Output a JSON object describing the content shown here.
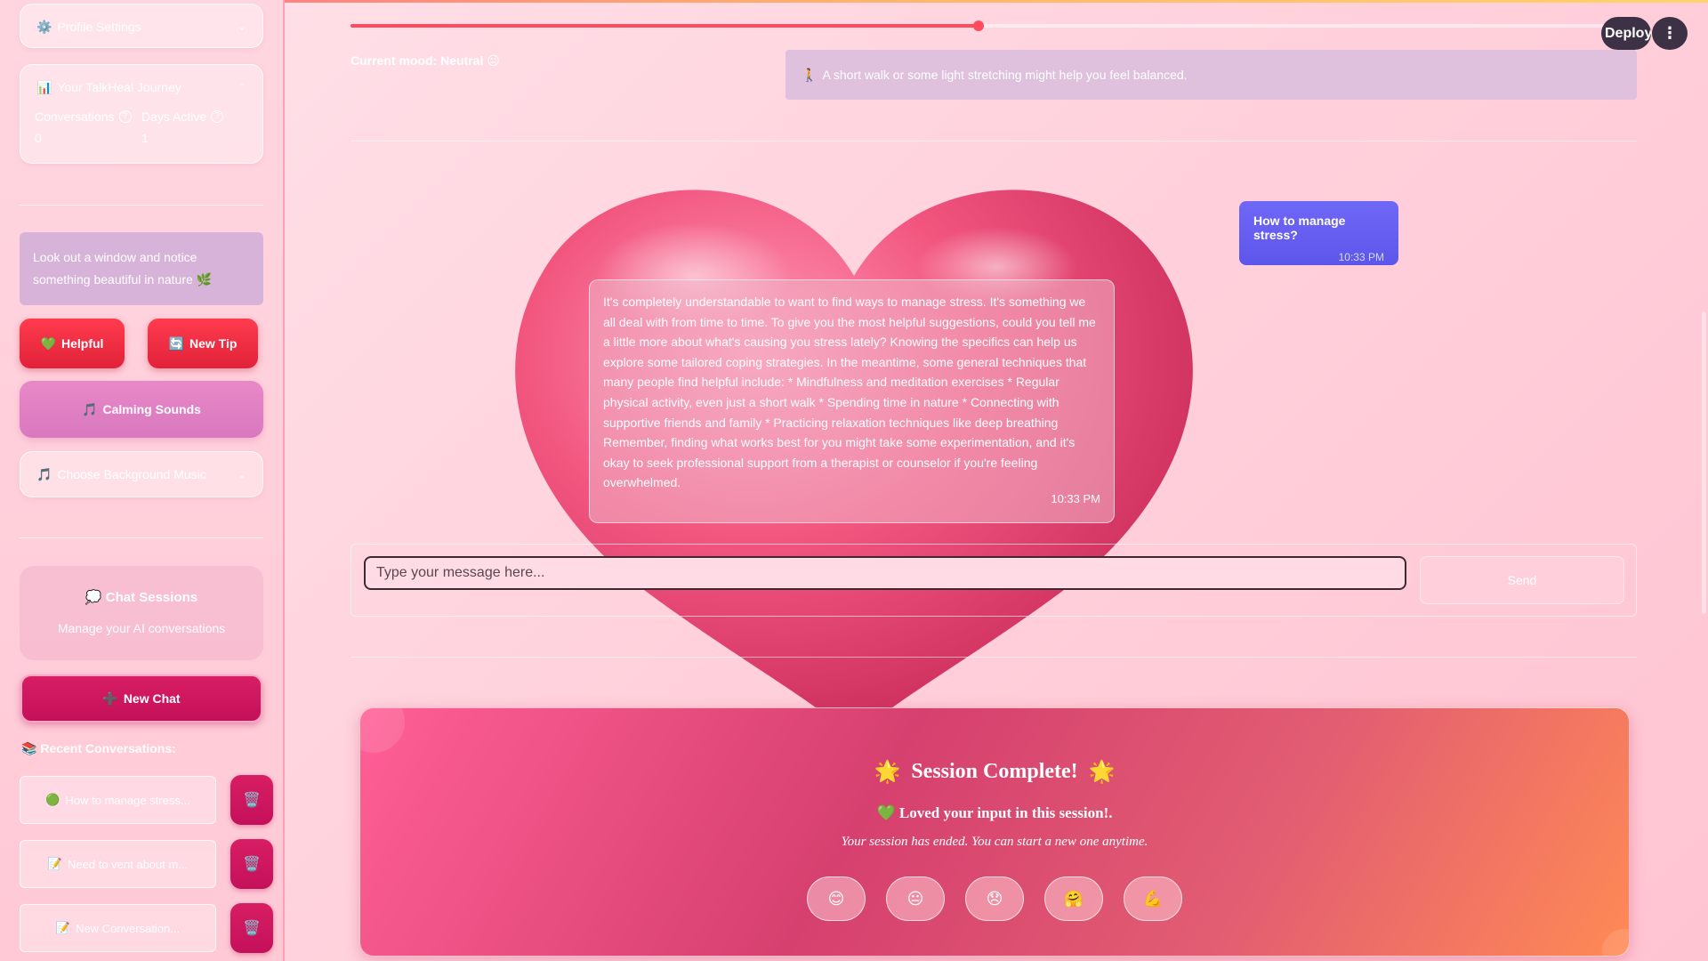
{
  "app": {
    "accent": "#ff4b5c",
    "brand": "#d81e64"
  },
  "sidebar": {
    "profile_settings": {
      "icon": "⚙️",
      "label": "Profile Settings"
    },
    "journey": {
      "icon": "📊",
      "label": "Your TalkHeal Journey",
      "metrics": [
        {
          "label": "Conversations",
          "value": "0"
        },
        {
          "label": "Days Active",
          "value": "1"
        }
      ]
    },
    "tip_text": "Look out a window and notice something beautiful in nature 🌿",
    "helpful": {
      "icon": "💚",
      "label": "Helpful"
    },
    "new_tip": {
      "icon": "🔄",
      "label": "New Tip"
    },
    "calming": {
      "icon": "🎵",
      "label": "Calming Sounds"
    },
    "music": {
      "icon": "🎵",
      "label": "Choose Background Music"
    },
    "chat_sessions": {
      "icon": "💭",
      "title": "Chat Sessions",
      "subtitle": "Manage your AI conversations"
    },
    "new_chat": {
      "icon": "➕",
      "label": "New Chat"
    },
    "recent_heading": {
      "icon": "📚",
      "label": "Recent Conversations:"
    },
    "conversations": [
      {
        "icon": "🟢",
        "label": "How to manage stress..."
      },
      {
        "icon": "📝",
        "label": "Need to vent about m..."
      },
      {
        "icon": "📝",
        "label": "New Conversation..."
      }
    ],
    "trash_icon": "🗑️"
  },
  "main": {
    "progress": 0.5,
    "mood": "Current mood: Neutral 😐",
    "suggestion": {
      "icon": "🚶",
      "text": "A short walk or some light stretching might help you feel balanced."
    },
    "deploy_label": "Deploy",
    "menu_icon": "⋮",
    "user_message": {
      "text": "How to manage stress?",
      "time": "10:33 PM"
    },
    "bot_message": {
      "text": "It's completely understandable to want to find ways to manage stress. It's something we all deal with from time to time. To give you the most helpful suggestions, could you tell me a little more about what's causing you stress lately? Knowing the specifics can help us explore some tailored coping strategies. In the meantime, some general techniques that many people find helpful include: * Mindfulness and meditation exercises * Regular physical activity, even just a short walk * Spending time in nature * Connecting with supportive friends and family * Practicing relaxation techniques like deep breathing Remember, finding what works best for you might take some experimentation, and it's okay to seek professional support from a therapist or counselor if you're feeling overwhelmed.",
      "time": "10:33 PM"
    },
    "input_placeholder": "Type your message here...",
    "send_label": "Send",
    "session": {
      "star": "🌟",
      "title": "Session Complete!",
      "loved_icon": "💚",
      "loved": "Loved your input in this session!.",
      "subtitle": "Your session has ended. You can start a new one anytime.",
      "emojis": [
        "😊",
        "😐",
        "😞",
        "🤗",
        "💪"
      ]
    }
  }
}
